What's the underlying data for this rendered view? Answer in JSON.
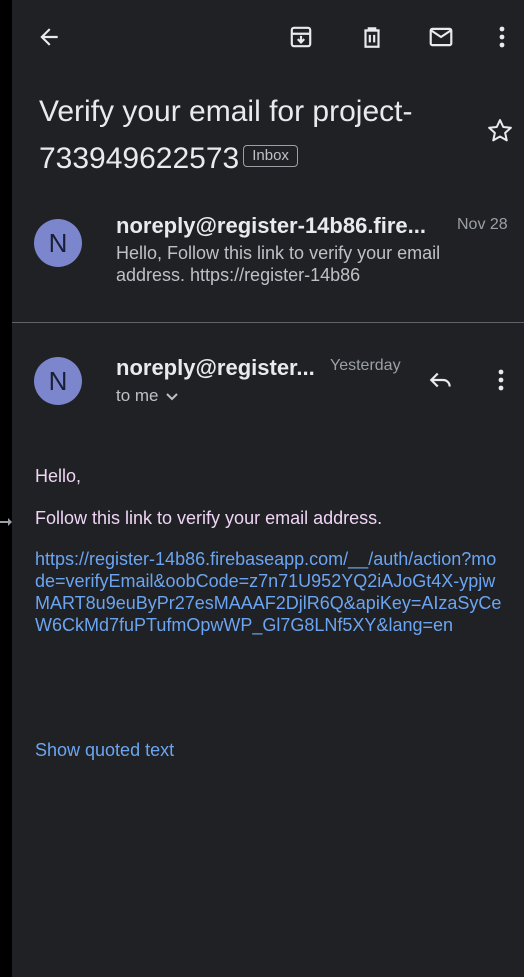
{
  "toolbar": {
    "back_icon": "arrow-left-icon",
    "archive_icon": "archive-icon",
    "delete_icon": "trash-icon",
    "mark_unread_icon": "mail-icon",
    "more_icon": "more-vert-icon"
  },
  "thread": {
    "subject": "Verify your email for project-733949622573",
    "label_chip": "Inbox"
  },
  "messages": [
    {
      "avatar_letter": "N",
      "sender": "noreply@register-14b86.fire...",
      "date": "Nov 28",
      "snippet": "Hello, Follow this link to verify your email address. https://register-14b86"
    },
    {
      "avatar_letter": "N",
      "sender": "noreply@register...",
      "date": "Yesterday",
      "recipient": "to me",
      "body": {
        "greeting": "Hello,",
        "line": "Follow this link to verify your email address.",
        "link": "https://register-14b86.firebaseapp.com/__/auth/action?mode=verifyEmail&oobCode=z7n71U952YQ2iAJoGt4X-ypjwMART8u9euByPr27esMAAAF2DjlR6Q&apiKey=AIzaSyCeW6CkMd7fuPTufmOpwWP_Gl7G8LNf5XY&lang=en",
        "show_quoted": "Show quoted text"
      }
    }
  ],
  "colors": {
    "background": "#202124",
    "avatar": "#7b86cc",
    "link": "#6ba5f2",
    "body_text": "#f0d4f5"
  }
}
